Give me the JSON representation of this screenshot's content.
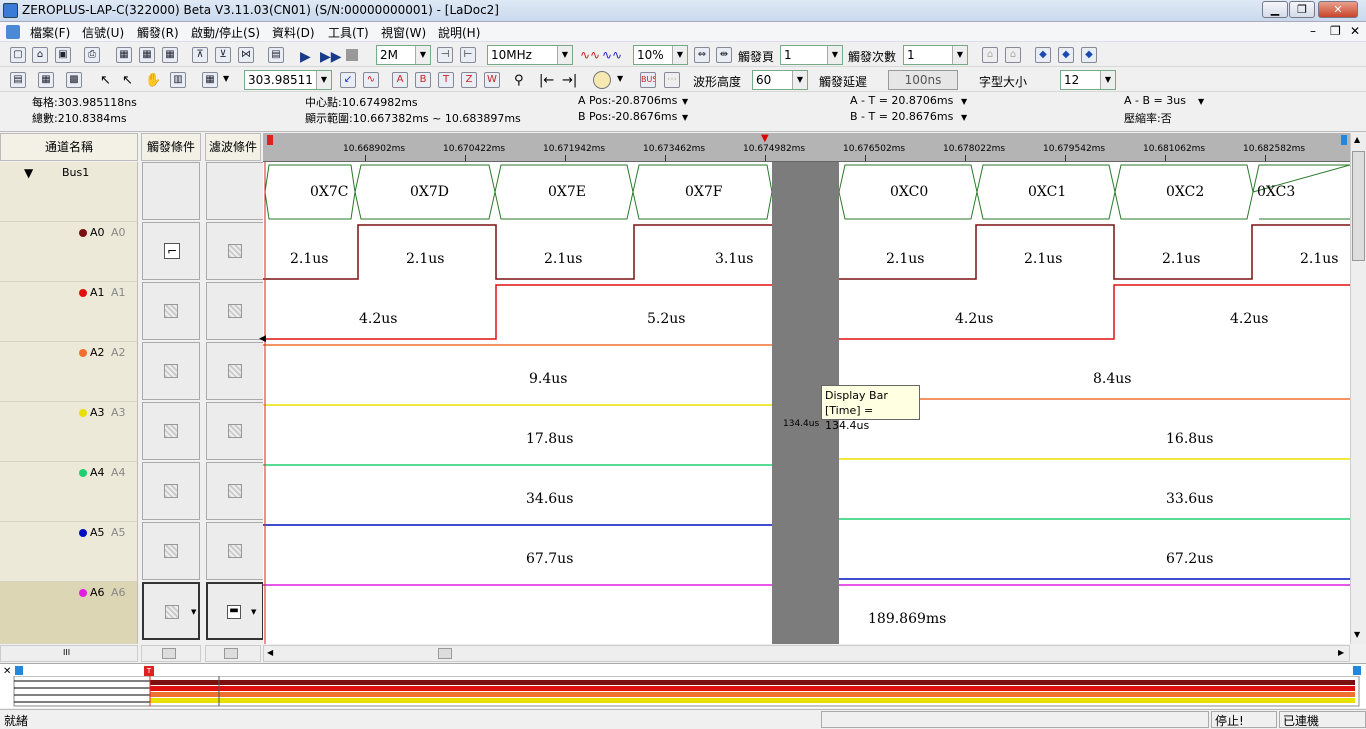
{
  "title_bar": {
    "title": "ZEROPLUS-LAP-C(322000) Beta V3.11.03(CN01) (S/N:00000000001) - [LaDoc2]"
  },
  "menu": [
    "檔案(F)",
    "信號(U)",
    "觸發(R)",
    "啟動/停止(S)",
    "資料(D)",
    "工具(T)",
    "視窗(W)",
    "說明(H)"
  ],
  "toolbar1": {
    "memory": "2M",
    "frequency": "10MHz",
    "zoom": "10%",
    "trigger_page_label": "觸發頁",
    "trigger_page": "1",
    "trigger_count_label": "觸發次數",
    "trigger_count": "1"
  },
  "toolbar2": {
    "position": "303.98511",
    "wave_height_label": "波形高度",
    "wave_height": "60",
    "trigger_delay_label": "觸發延遲",
    "trigger_delay": "100ns",
    "font_size_label": "字型大小",
    "font_size": "12"
  },
  "info": {
    "per_div": "每格:303.985118ns",
    "total": "總數:210.8384ms",
    "center": "中心點:10.674982ms",
    "range": "顯示範圍:10.667382ms ~ 10.683897ms",
    "a_pos": "A Pos:-20.8706ms",
    "b_pos": "B Pos:-20.8676ms",
    "a_t": "A - T = 20.8706ms",
    "b_t": "B - T = 20.8676ms",
    "a_b": "A - B = 3us",
    "compress": "壓縮率:否"
  },
  "headers": {
    "channel_name": "通道名稱",
    "trigger_cond": "觸發條件",
    "filter_cond": "濾波條件"
  },
  "channels": [
    {
      "name": "Bus1",
      "alias": ""
    },
    {
      "name": "A0",
      "alias": "A0",
      "color": "#7b1010"
    },
    {
      "name": "A1",
      "alias": "A1",
      "color": "#e01010"
    },
    {
      "name": "A2",
      "alias": "A2",
      "color": "#f07030"
    },
    {
      "name": "A3",
      "alias": "A3",
      "color": "#e8e000"
    },
    {
      "name": "A4",
      "alias": "A4",
      "color": "#20d070"
    },
    {
      "name": "A5",
      "alias": "A5",
      "color": "#0010c0"
    },
    {
      "name": "A6",
      "alias": "A6",
      "color": "#e020e0"
    }
  ],
  "ruler": {
    "ticks": [
      "10.668902ms",
      "10.670422ms",
      "10.671942ms",
      "10.673462ms",
      "10.674982ms",
      "10.676502ms",
      "10.678022ms",
      "10.679542ms",
      "10.681062ms",
      "10.682582ms"
    ]
  },
  "bus_values": [
    "0X7C",
    "0X7D",
    "0X7E",
    "0X7F",
    "0XC0",
    "0XC1",
    "0XC2",
    "0XC3"
  ],
  "widths": {
    "a0": [
      "2.1us",
      "2.1us",
      "2.1us",
      "3.1us",
      "2.1us",
      "2.1us",
      "2.1us",
      "2.1us"
    ],
    "a1": [
      "4.2us",
      "5.2us",
      "4.2us",
      "4.2us"
    ],
    "a2": [
      "9.4us",
      "8.4us"
    ],
    "a3": [
      "17.8us",
      "16.8us"
    ],
    "a4": [
      "34.6us",
      "33.6us"
    ],
    "a5": [
      "67.7us",
      "67.2us"
    ],
    "a6": [
      "189.869ms"
    ]
  },
  "display_bar": {
    "band_label": "134.4us",
    "tooltip_title": "Display Bar",
    "tooltip_value": "[Time] = 134.4us"
  },
  "status": {
    "ready": "就緒",
    "stopped": "停止!",
    "connected": "已連機"
  }
}
